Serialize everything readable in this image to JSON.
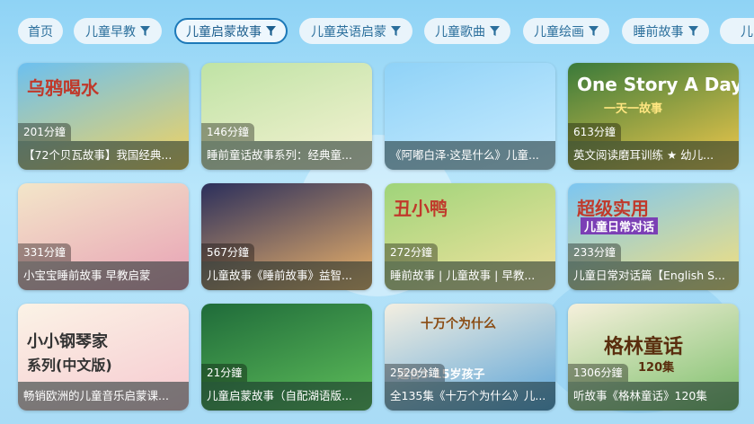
{
  "tabs": [
    {
      "label": "首页",
      "filter": false,
      "active": false
    },
    {
      "label": "儿童早教",
      "filter": true,
      "active": false
    },
    {
      "label": "儿童启蒙故事",
      "filter": true,
      "active": true
    },
    {
      "label": "儿童英语启蒙",
      "filter": true,
      "active": false
    },
    {
      "label": "儿童歌曲",
      "filter": true,
      "active": false
    },
    {
      "label": "儿童绘画",
      "filter": true,
      "active": false
    },
    {
      "label": "睡前故事",
      "filter": true,
      "active": false
    },
    {
      "label": "儿",
      "filter": false,
      "active": false
    }
  ],
  "cards": [
    {
      "duration": "201分鐘",
      "caption": "【72个贝瓦故事】我国经典...",
      "thumb_text": "乌鸦喝水",
      "palette": [
        "#6cc0f0",
        "#f4d35e"
      ]
    },
    {
      "duration": "146分鐘",
      "caption": "睡前童话故事系列：经典童...",
      "thumb_text": "",
      "palette": [
        "#bfe3a5",
        "#f7f2d4"
      ]
    },
    {
      "duration": "",
      "caption": "《阿嘟白泽·这是什么》儿童...",
      "thumb_text": "",
      "palette": [
        "#8fd2f7",
        "#c9ecff"
      ]
    },
    {
      "duration": "613分鐘",
      "caption": "英文阅读磨耳训练 ★ 幼儿...",
      "thumb_text": "One Story A Day",
      "thumb_text2": "一天一故事",
      "palette": [
        "#3a7a3a",
        "#f2c94c"
      ]
    },
    {
      "duration": "331分鐘",
      "caption": "小宝宝睡前故事 早教启蒙",
      "thumb_text": "",
      "palette": [
        "#f3e6c9",
        "#e8a0b5"
      ]
    },
    {
      "duration": "567分鐘",
      "caption": "儿童故事《睡前故事》益智...",
      "thumb_text": "",
      "palette": [
        "#2b2f5c",
        "#f0b56a"
      ]
    },
    {
      "duration": "272分鐘",
      "caption": "睡前故事 | 儿童故事 | 早教...",
      "thumb_text": "丑小鸭",
      "palette": [
        "#9fd47a",
        "#f5e3a0"
      ]
    },
    {
      "duration": "233分鐘",
      "caption": "儿童日常对话篇【English S...",
      "thumb_text": "超级实用",
      "thumb_text2": "儿童日常对话",
      "palette": [
        "#7cc6f2",
        "#f7e07a"
      ]
    },
    {
      "duration": "",
      "caption": "畅销欧洲的儿童音乐启蒙课...",
      "thumb_text": "小小钢琴家",
      "thumb_text2": "系列(中文版)",
      "palette": [
        "#fbf3e6",
        "#f6c9d0"
      ]
    },
    {
      "duration": "21分鐘",
      "caption": "儿童启蒙故事（自配湖语版...",
      "thumb_text": "",
      "palette": [
        "#1f6b3a",
        "#5fbf5a"
      ]
    },
    {
      "duration": "2520分鐘",
      "caption": "全135集《十万个为什么》儿...",
      "thumb_text": "十万个为什么",
      "thumb_text2": "适合3-15岁孩子",
      "palette": [
        "#f4efe1",
        "#5ba4d8"
      ]
    },
    {
      "duration": "1306分鐘",
      "caption": "听故事《格林童话》120集",
      "thumb_text": "格林童话",
      "thumb_text2": "120集",
      "palette": [
        "#f6f0dc",
        "#7cbf6a"
      ]
    }
  ]
}
